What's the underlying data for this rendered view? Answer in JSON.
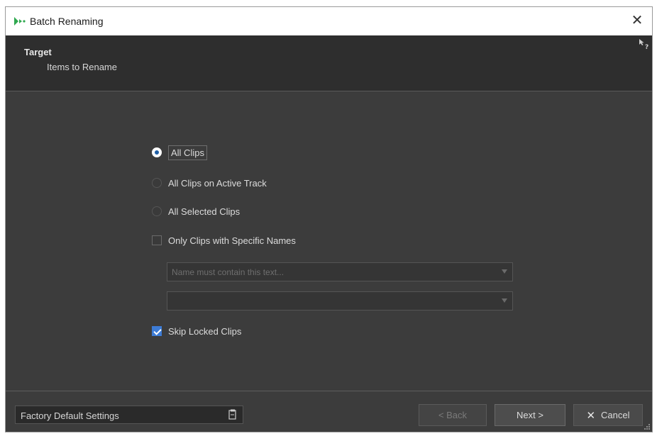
{
  "window": {
    "title": "Batch Renaming"
  },
  "header": {
    "title": "Target",
    "subtitle": "Items to Rename"
  },
  "options": {
    "all_clips": {
      "label": "All Clips",
      "selected": true
    },
    "all_clips_active_track": {
      "label": "All Clips on Active Track",
      "selected": false
    },
    "all_selected_clips": {
      "label": "All Selected Clips",
      "selected": false
    },
    "only_specific_names": {
      "label": "Only Clips with Specific Names",
      "checked": false
    },
    "skip_locked": {
      "label": "Skip Locked Clips",
      "checked": true
    }
  },
  "filters": {
    "name_condition": {
      "placeholder": "Name must contain this text..."
    },
    "name_text": {
      "value": ""
    }
  },
  "footer": {
    "preset": "Factory Default Settings",
    "back_label": "< Back",
    "next_label": "Next >",
    "cancel_label": "Cancel"
  },
  "colors": {
    "accent": "#3d7cd6",
    "background": "#3c3c3c",
    "header": "#2e2e2e"
  }
}
